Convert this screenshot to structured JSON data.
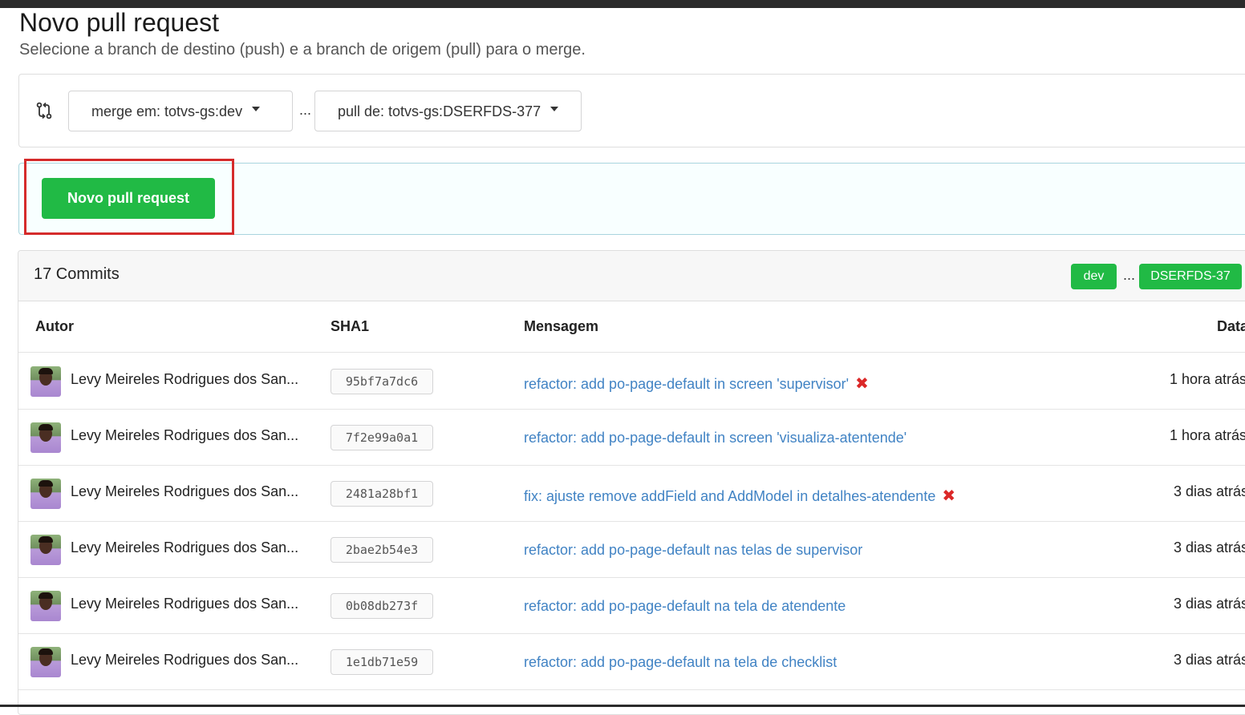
{
  "page": {
    "title": "Novo pull request",
    "subtitle": "Selecione a branch de destino (push) e a branch de origem (pull) para o merge."
  },
  "branches": {
    "base_label": "merge em: totvs-gs:dev",
    "separator": "...",
    "head_label": "pull de: totvs-gs:DSERFDS-377"
  },
  "action": {
    "new_pr_label": "Novo pull request"
  },
  "commits": {
    "count_label": "17 Commits",
    "base_branch": "dev",
    "separator": "...",
    "head_branch": "DSERFDS-37",
    "columns": {
      "author": "Autor",
      "sha": "SHA1",
      "message": "Mensagem",
      "date": "Data"
    },
    "rows": [
      {
        "author": "Levy Meireles Rodrigues dos San...",
        "sha": "95bf7a7dc6",
        "message": "refactor: add po-page-default in screen 'supervisor'",
        "status": "✖",
        "date": "1 hora atrás"
      },
      {
        "author": "Levy Meireles Rodrigues dos San...",
        "sha": "7f2e99a0a1",
        "message": "refactor: add po-page-default in screen 'visualiza-atentende'",
        "status": "",
        "date": "1 hora atrás"
      },
      {
        "author": "Levy Meireles Rodrigues dos San...",
        "sha": "2481a28bf1",
        "message": "fix: ajuste remove addField and AddModel in detalhes-atendente",
        "status": "✖",
        "date": "3 dias atrás"
      },
      {
        "author": "Levy Meireles Rodrigues dos San...",
        "sha": "2bae2b54e3",
        "message": "refactor: add po-page-default nas telas de supervisor",
        "status": "",
        "date": "3 dias atrás"
      },
      {
        "author": "Levy Meireles Rodrigues dos San...",
        "sha": "0b08db273f",
        "message": "refactor: add po-page-default na tela de atendente",
        "status": "",
        "date": "3 dias atrás"
      },
      {
        "author": "Levy Meireles Rodrigues dos San...",
        "sha": "1e1db71e59",
        "message": "refactor: add po-page-default na tela de checklist",
        "status": "",
        "date": "3 dias atrás"
      }
    ]
  },
  "icons": {
    "compare": "git-compare-icon",
    "dropdown": "caret-down-icon",
    "status_failed": "x-icon"
  },
  "colors": {
    "primary_green": "#21ba45",
    "link_blue": "#4183c4",
    "error_red": "#db2828",
    "highlight_red": "#d52b2b"
  }
}
